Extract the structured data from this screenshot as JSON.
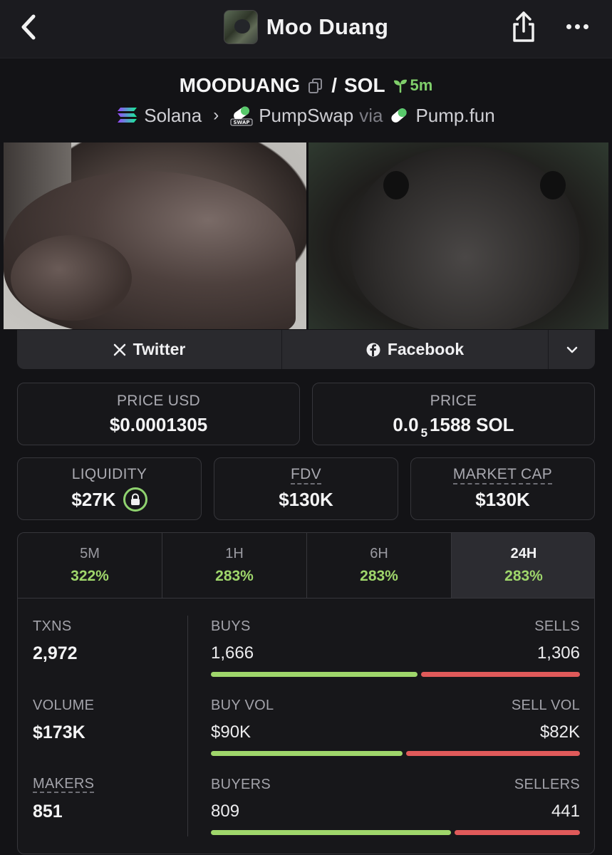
{
  "nav": {
    "title": "Moo Duang",
    "back_icon": "chevron-left-icon",
    "share_icon": "share-icon",
    "more_icon": "more-horizontal-icon"
  },
  "pair": {
    "base": "MOODUANG",
    "separator": "/",
    "quote": "SOL",
    "age": "5m",
    "chain": "Solana",
    "dex": "PumpSwap",
    "via": "via",
    "launchpad": "Pump.fun",
    "dex_badge": "SWAP"
  },
  "social": {
    "twitter_label": "Twitter",
    "facebook_label": "Facebook"
  },
  "prices": {
    "price_usd_label": "PRICE USD",
    "price_usd_value": "$0.0001305",
    "price_label": "PRICE",
    "price_prefix": "0.0",
    "price_subscript": "5",
    "price_suffix": "1588 SOL",
    "liquidity_label": "LIQUIDITY",
    "liquidity_value": "$27K",
    "fdv_label": "FDV",
    "fdv_value": "$130K",
    "mcap_label": "MARKET CAP",
    "mcap_value": "$130K"
  },
  "timeframes": [
    {
      "label": "5M",
      "change": "322%",
      "active": false
    },
    {
      "label": "1H",
      "change": "283%",
      "active": false
    },
    {
      "label": "6H",
      "change": "283%",
      "active": false
    },
    {
      "label": "24H",
      "change": "283%",
      "active": true
    }
  ],
  "stats": {
    "txns_label": "TXNS",
    "txns_value": "2,972",
    "volume_label": "VOLUME",
    "volume_value": "$173K",
    "makers_label": "MAKERS",
    "makers_value": "851"
  },
  "splits": {
    "buys_label": "BUYS",
    "sells_label": "SELLS",
    "buys_value": "1,666",
    "sells_value": "1,306",
    "buys_fraction": 0.56,
    "buy_vol_label": "BUY VOL",
    "sell_vol_label": "SELL VOL",
    "buy_vol_value": "$90K",
    "sell_vol_value": "$82K",
    "buy_vol_fraction": 0.52,
    "buyers_label": "BUYERS",
    "sellers_label": "SELLERS",
    "buyers_value": "809",
    "sellers_value": "441",
    "buyers_fraction": 0.65
  },
  "colors": {
    "buy": "#9fd66b",
    "sell": "#e05a5a",
    "age": "#7fce6a"
  }
}
